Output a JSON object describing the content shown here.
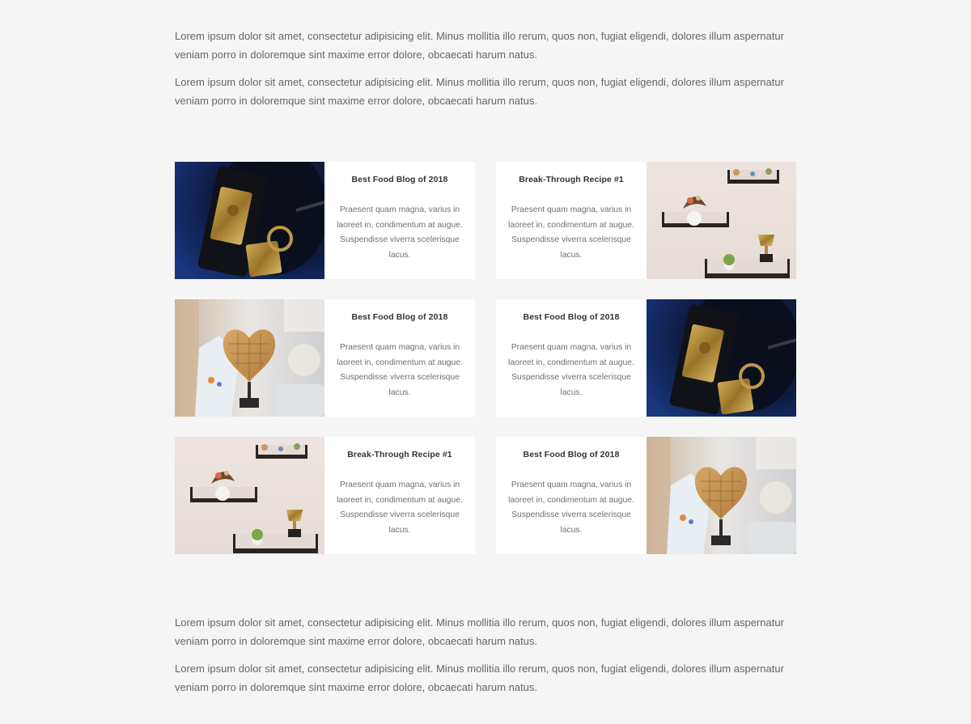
{
  "intro": [
    "Lorem ipsum dolor sit amet, consectetur adipisicing elit. Minus mollitia illo rerum, quos non, fugiat eligendi, dolores illum aspernatur veniam porro in doloremque sint maxime error dolore, obcaecati harum natus.",
    "Lorem ipsum dolor sit amet, consectetur adipisicing elit. Minus mollitia illo rerum, quos non, fugiat eligendi, dolores illum aspernatur veniam porro in doloremque sint maxime error dolore, obcaecati harum natus."
  ],
  "cards": [
    {
      "title": "Best Food Blog of 2018",
      "text": "Praesent quam magna, varius in laoreet in, condimentum at augue. Suspendisse viverra scelerisque lacus.",
      "image": "award-plaque-photo"
    },
    {
      "title": "Break-Through Recipe #1",
      "text": "Praesent quam magna, varius in laoreet in, condimentum at augue. Suspendisse viverra scelerisque lacus.",
      "image": "shelves-trophy-photo"
    },
    {
      "title": "Best Food Blog of 2018",
      "text": "Praesent quam magna, varius in laoreet in, condimentum at augue. Suspendisse viverra scelerisque lacus.",
      "image": "heart-waffle-trophy-photo"
    },
    {
      "title": "Best Food Blog of 2018",
      "text": "Praesent quam magna, varius in laoreet in, condimentum at augue. Suspendisse viverra scelerisque lacus.",
      "image": "award-plaque-photo"
    },
    {
      "title": "Break-Through Recipe #1",
      "text": "Praesent quam magna, varius in laoreet in, condimentum at augue. Suspendisse viverra scelerisque lacus.",
      "image": "shelves-trophy-photo"
    },
    {
      "title": "Best Food Blog of 2018",
      "text": "Praesent quam magna, varius in laoreet in, condimentum at augue. Suspendisse viverra scelerisque lacus.",
      "image": "heart-waffle-trophy-photo"
    }
  ],
  "outro": [
    "Lorem ipsum dolor sit amet, consectetur adipisicing elit. Minus mollitia illo rerum, quos non, fugiat eligendi, dolores illum aspernatur veniam porro in doloremque sint maxime error dolore, obcaecati harum natus.",
    "Lorem ipsum dolor sit amet, consectetur adipisicing elit. Minus mollitia illo rerum, quos non, fugiat eligendi, dolores illum aspernatur veniam porro in doloremque sint maxime error dolore, obcaecati harum natus."
  ],
  "colors": {
    "background": "#f5f5f5",
    "card": "#ffffff",
    "title": "#333333",
    "text": "#666666"
  }
}
